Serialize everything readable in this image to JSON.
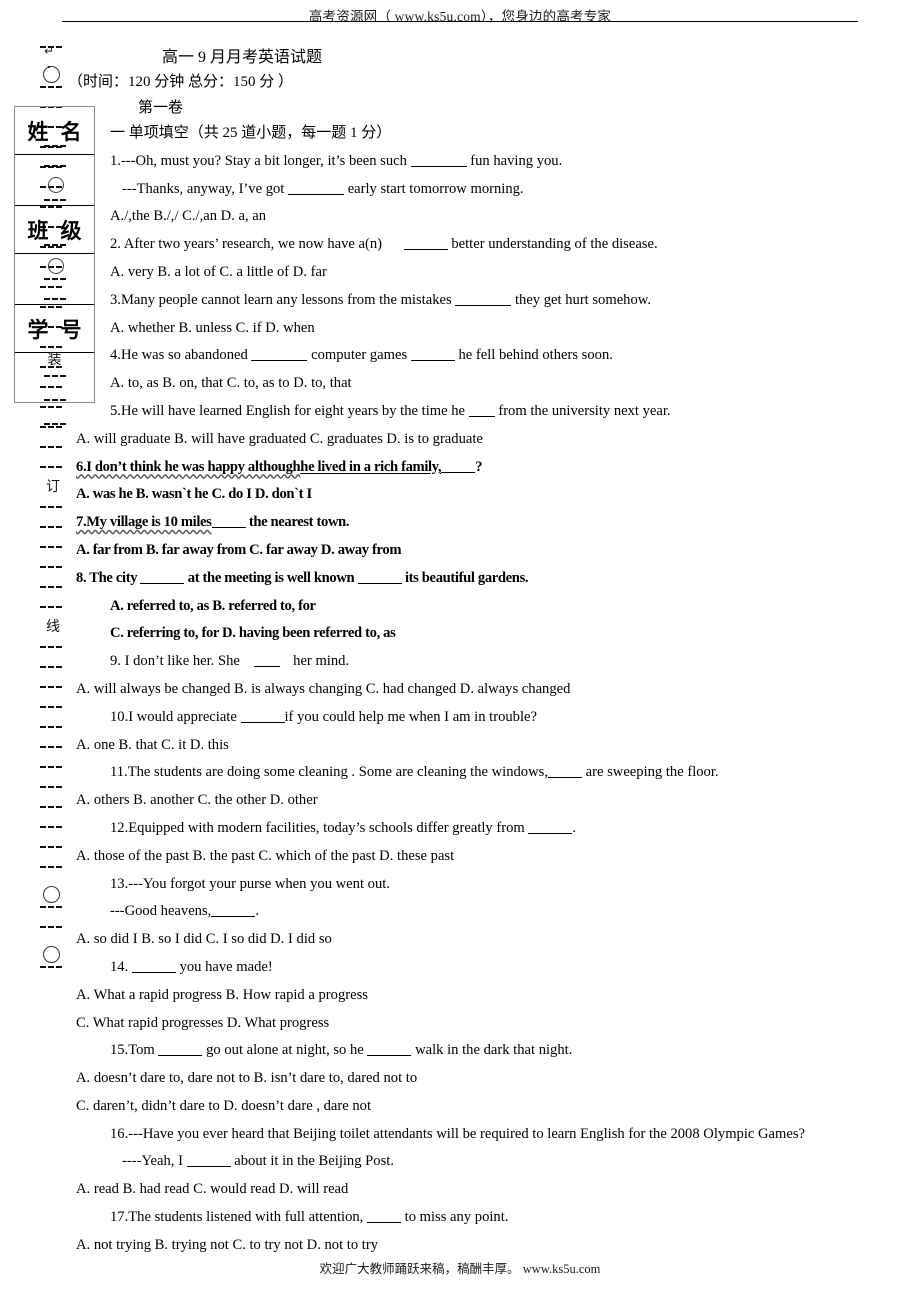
{
  "header": {
    "text": "高考资源网（ www.ks5u.com），您身边的高考专家"
  },
  "footer": {
    "text": "欢迎广大教师踊跃来稿，稿酬丰厚。 www.ks5u.com"
  },
  "seal_strip": {
    "arrow_icon": "↵",
    "chars": [
      "装",
      "订",
      "线"
    ]
  },
  "id_boxes": [
    {
      "label": "姓名"
    },
    {
      "label": "班级"
    },
    {
      "label": "学号"
    }
  ],
  "document": {
    "title": "高一 9 月月考英语试题",
    "subtitle": "（时间：120 分钟 总分：150 分 ）",
    "part": "第一卷",
    "section_head": "一 单项填空（共 25 道小题，每一题 1 分）"
  },
  "questions": [
    {
      "id": "q1",
      "stem_a": "1.---Oh, must you? Stay a bit longer, it’s been such",
      "stem_a_tail": "fun having you.",
      "stem_b": "---Thanks, anyway, I’ve got",
      "stem_b_tail": "early start tomorrow morning.",
      "options": "A./,the      B./,/      C./,an     D. a, an"
    },
    {
      "id": "q2",
      "stem": "2. After two years’ research, we now have a(n)",
      "stem_tail": "better understanding of the disease.",
      "options": "A. very        B. a lot of       C. a little of           D. far"
    },
    {
      "id": "q3",
      "stem": "3.Many people cannot learn any lessons from the mistakes",
      "stem_tail": "they get hurt somehow.",
      "options": "A. whether       B. unless         C. if     D. when"
    },
    {
      "id": "q4",
      "stem": "4.He was so abandoned",
      "stem_mid": "computer games",
      "stem_tail": "he fell behind others soon.",
      "options": "A. to, as       B. on, that     C. to, as to     D. to, that"
    },
    {
      "id": "q5",
      "stem": "5.He will have learned English for eight years by the time he",
      "stem_tail": "from the university next year.",
      "options": "A. will graduate      B. will have graduated    C. graduates    D. is to graduate"
    },
    {
      "id": "q6",
      "stem_underlined": "6.I don’t think he was happy although",
      "stem_underlined_2": "he lived in a rich family,",
      "stem_tail": "?",
      "options": "A. was he        B. wasn`t he      C. do I     D. don`t I"
    },
    {
      "id": "q7",
      "stem_underlined": "7.My village is 10 miles",
      "stem_tail": "the nearest town.",
      "options": "A. far from       B. far away from      C. far away        D. away from"
    },
    {
      "id": "q8",
      "stem": "8. The city",
      "stem_mid": "at the meeting is well known",
      "stem_tail": "its beautiful gardens.",
      "options_a": "A. referred to, as       B. referred to, for",
      "options_b": "C. referring to, for      D. having been referred to, as"
    },
    {
      "id": "q9",
      "stem": "9. I don’t like her. She",
      "stem_tail": "her mind.",
      "options": "A. will always be changed B. is always changing C. had changed      D. always changed"
    },
    {
      "id": "q10",
      "stem": "10.I would appreciate",
      "stem_tail": "if you could help me when I am in trouble?",
      "options": "A. one     B. that      C. it      D. this"
    },
    {
      "id": "q11",
      "stem": "11.The students are doing some cleaning . Some are cleaning the windows,",
      "stem_tail": "are sweeping the floor.",
      "options": "A. others      B. another     C. the other    D. other"
    },
    {
      "id": "q12",
      "stem": "12.Equipped with modern facilities, today’s schools differ greatly from",
      "stem_tail": ".",
      "options": "A. those of the past      B. the past    C. which of the past   D. these past"
    },
    {
      "id": "q13",
      "stem_a": "13.---You forgot your purse when you went out.",
      "stem_b": "---Good heavens,",
      "stem_b_tail": ".",
      "options": "A. so did I    B. so I did    C. I so did   D. I did so"
    },
    {
      "id": "q14",
      "stem": "14.",
      "stem_tail": "you have made!",
      "options_a": "A. What a rapid progress    B. How rapid a progress",
      "options_b": "C. What rapid progresses   D. What progress"
    },
    {
      "id": "q15",
      "stem": "15.Tom",
      "stem_mid": "go out alone at night, so he",
      "stem_tail": "walk in the dark that night.",
      "options_a": "A. doesn’t dare to, dare not to      B. isn’t dare to, dared not to",
      "options_b": "C. daren’t, didn’t dare to             D. doesn’t dare , dare not"
    },
    {
      "id": "q16",
      "stem_a": "16.---Have you ever heard that Beijing toilet attendants will be required to learn English for the 2008 Olympic Games?",
      "stem_b": "----Yeah, I",
      "stem_b_tail": "about it in the Beijing Post.",
      "options": "A. read      B. had read       C. would read       D. will read"
    },
    {
      "id": "q17",
      "stem": "17.The students listened with full attention,",
      "stem_tail": "to miss any point.",
      "options": "A. not trying     B. trying not     C. to try not      D. not to try"
    }
  ]
}
